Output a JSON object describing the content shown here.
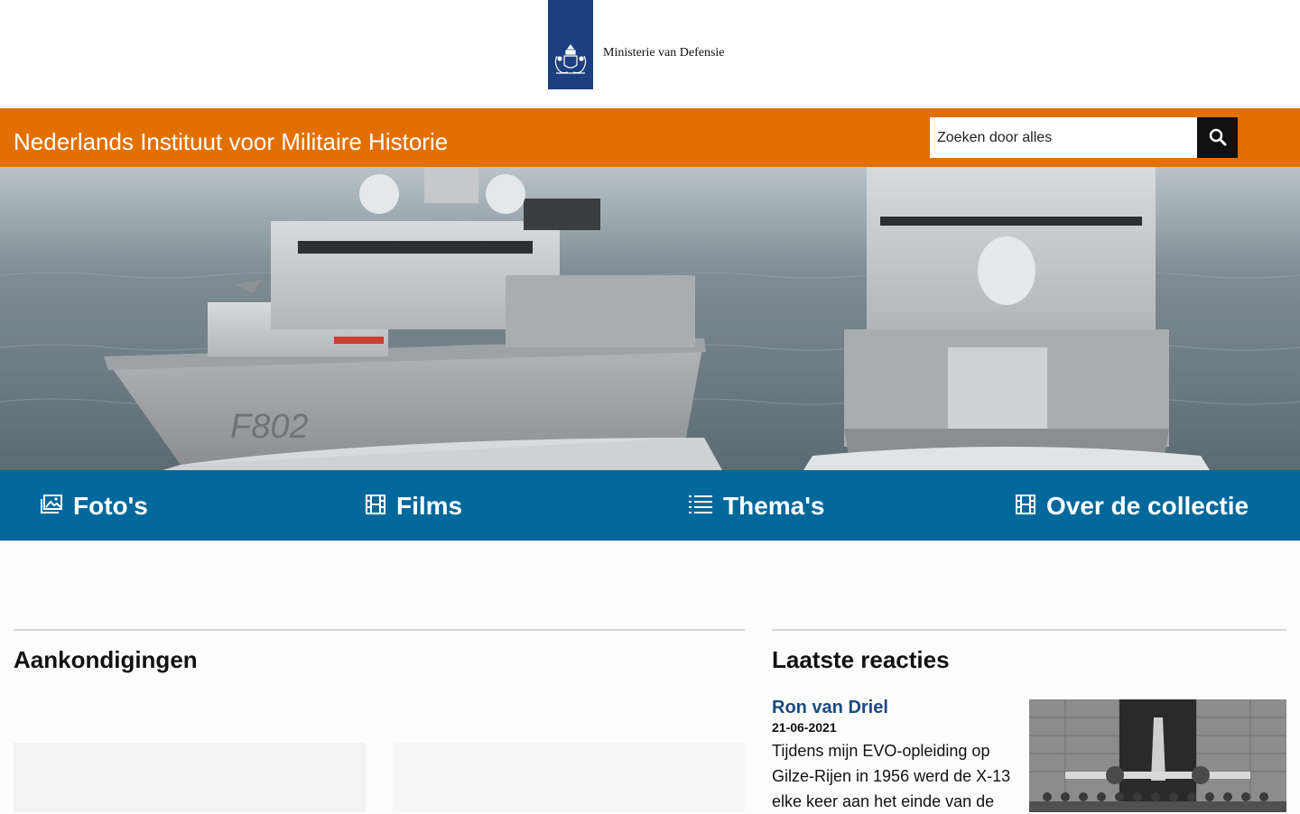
{
  "header": {
    "ministry_name": "Ministerie van Defensie",
    "site_title": "Nederlands Instituut voor Militaire Historie"
  },
  "search": {
    "placeholder": "Zoeken door alles",
    "icon": "search-icon"
  },
  "hero": {
    "hull_number": "F802",
    "alt_subject": "frigates-at-sea"
  },
  "nav": {
    "items": [
      {
        "label": "Foto's",
        "icon": "photos-icon"
      },
      {
        "label": "Films",
        "icon": "film-icon"
      },
      {
        "label": "Thema's",
        "icon": "list-icon"
      },
      {
        "label": "Over de collectie",
        "icon": "film-icon"
      }
    ]
  },
  "sections": {
    "announcements_title": "Aankondigingen",
    "reactions_title": "Laatste reacties"
  },
  "reactions": [
    {
      "author": "Ron van Driel",
      "date": "21-06-2021",
      "text": "Tijdens mijn EVO-opleiding op Gilze-Rijen in 1956 werd de X-13 elke keer aan het einde van de"
    }
  ],
  "colors": {
    "orange": "#e17000",
    "nav_blue": "#01689b",
    "logo_blue": "#1b3f80",
    "link_blue": "#1b4a82"
  }
}
